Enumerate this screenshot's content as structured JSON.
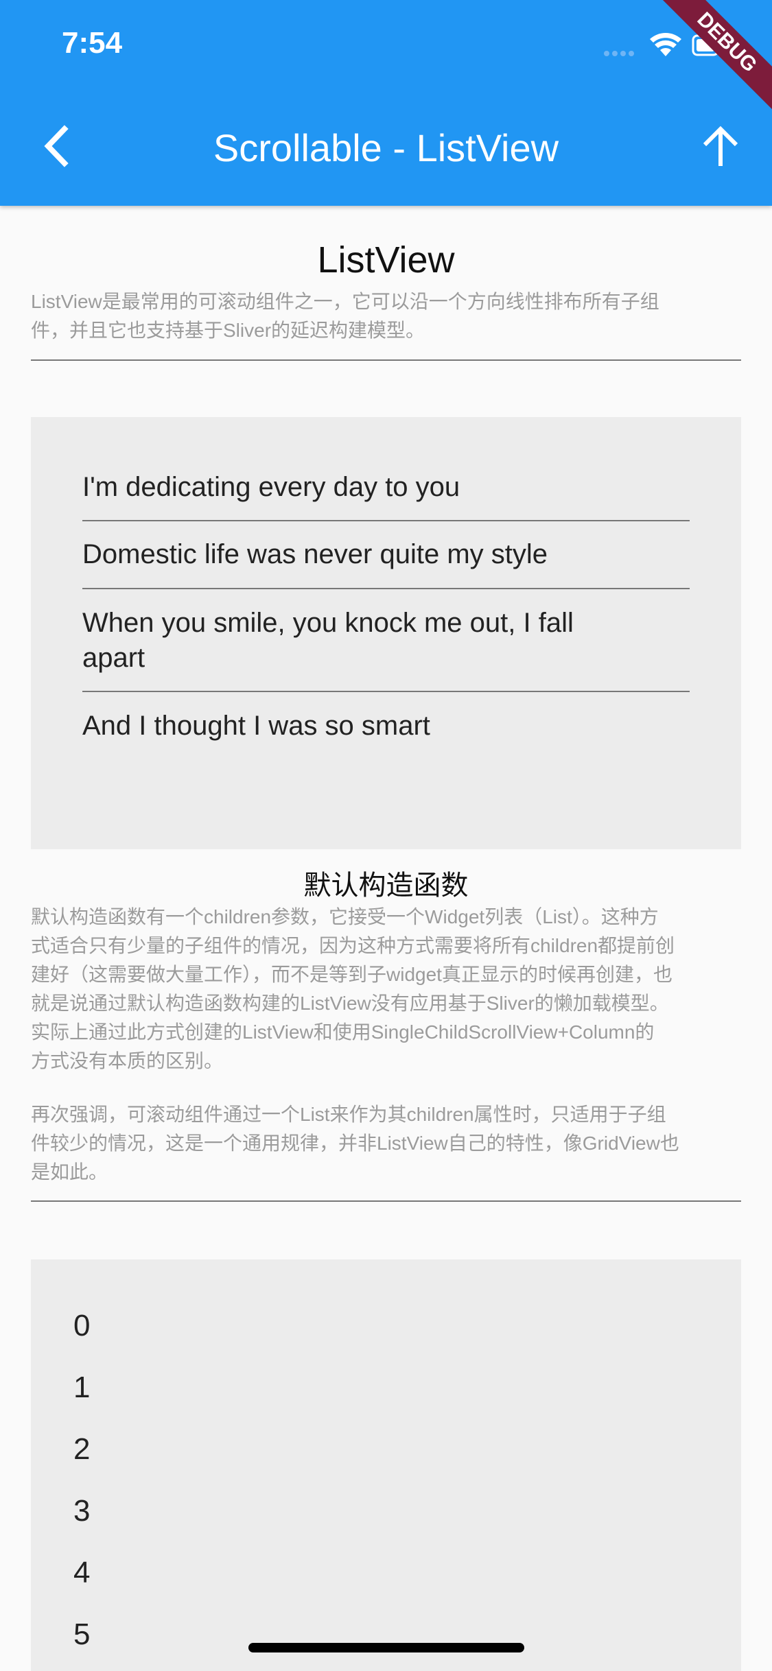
{
  "status_bar": {
    "time": "7:54",
    "debug_label": "DEBUG"
  },
  "app_bar": {
    "title": "Scrollable - ListView",
    "back_icon": "chevron-left-icon",
    "up_icon": "arrow-up-icon"
  },
  "intro": {
    "heading": "ListView",
    "description_line1": "ListView是最常用的可滚动组件之一，它可以沿一个方向线性排布所有子组",
    "description_line2": "件，并且它也支持基于Sliver的延迟构建模型。"
  },
  "demo1": {
    "items": [
      "I'm dedicating every day to you",
      "Domestic life was never quite my style",
      "When you smile, you knock me out, I fall",
      "apart",
      "And I thought I was so smart"
    ]
  },
  "section2": {
    "heading": "默认构造函数",
    "paragraph1_lines": [
      "默认构造函数有一个children参数，它接受一个Widget列表（List）。这种方",
      "式适合只有少量的子组件的情况，因为这种方式需要将所有children都提前创",
      "建好（这需要做大量工作），而不是等到子widget真正显示的时候再创建，也",
      "就是说通过默认构造函数构建的ListView没有应用基于Sliver的懒加载模型。",
      "实际上通过此方式创建的ListView和使用SingleChildScrollView+Column的",
      "方式没有本质的区别。"
    ],
    "paragraph2_lines": [
      "再次强调，可滚动组件通过一个List来作为其children属性时，只适用于子组",
      "件较少的情况，这是一个通用规律，并非ListView自己的特性，像GridView也",
      "是如此。"
    ]
  },
  "demo2": {
    "numbers": [
      "0",
      "1",
      "2",
      "3",
      "4",
      "5"
    ]
  },
  "colors": {
    "primary": "#2196f3",
    "debug": "#7d1c3b",
    "card": "#ececec",
    "secondary_text": "#9b9b9b"
  }
}
